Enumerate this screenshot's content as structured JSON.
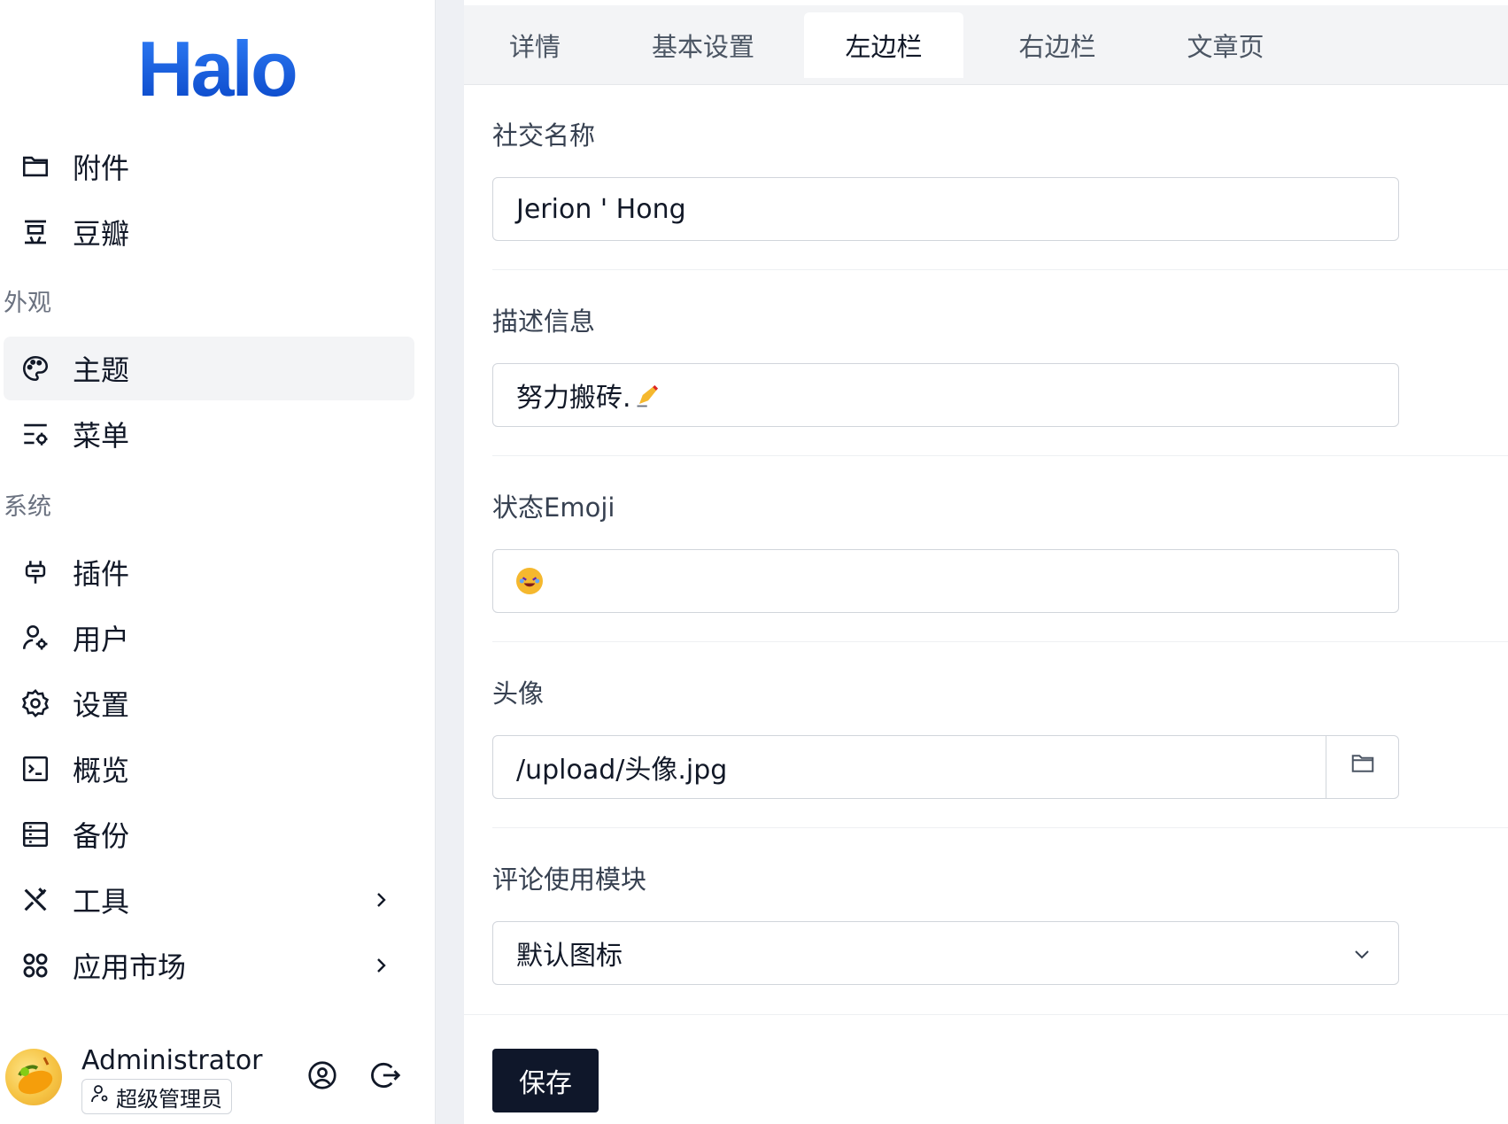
{
  "sidebar": {
    "logo": "Halo",
    "items_top": [
      {
        "label": "附件",
        "icon": "folder-icon"
      },
      {
        "label": "豆瓣",
        "icon": "douban-icon"
      }
    ],
    "group_appearance": "外观",
    "items_appearance": [
      {
        "label": "主题",
        "icon": "palette-icon",
        "active": true
      },
      {
        "label": "菜单",
        "icon": "menu-settings-icon"
      }
    ],
    "group_system": "系统",
    "items_system": [
      {
        "label": "插件",
        "icon": "plug-icon"
      },
      {
        "label": "用户",
        "icon": "user-settings-icon"
      },
      {
        "label": "设置",
        "icon": "gear-icon"
      },
      {
        "label": "概览",
        "icon": "terminal-icon"
      },
      {
        "label": "备份",
        "icon": "database-icon"
      },
      {
        "label": "工具",
        "icon": "tools-icon",
        "has_children": true
      },
      {
        "label": "应用市场",
        "icon": "apps-icon",
        "has_children": true
      }
    ],
    "user": {
      "name": "Administrator",
      "role": "超级管理员"
    }
  },
  "tabs": [
    {
      "label": "详情",
      "active": false
    },
    {
      "label": "基本设置",
      "active": false
    },
    {
      "label": "左边栏",
      "active": true
    },
    {
      "label": "右边栏",
      "active": false
    },
    {
      "label": "文章页",
      "active": false
    }
  ],
  "form": {
    "social_name": {
      "label": "社交名称",
      "value": "Jerion ' Hong"
    },
    "description": {
      "label": "描述信息",
      "value": "努力搬砖."
    },
    "status_emoji": {
      "label": "状态Emoji"
    },
    "avatar": {
      "label": "头像",
      "value": "/upload/头像.jpg"
    },
    "comment_module": {
      "label": "评论使用模块",
      "value": "默认图标"
    }
  },
  "actions": {
    "save": "保存"
  },
  "colors": {
    "primary_button": "#0f172a",
    "active_nav_bg": "#f3f4f6",
    "logo_blue": "#0b5ed7"
  }
}
